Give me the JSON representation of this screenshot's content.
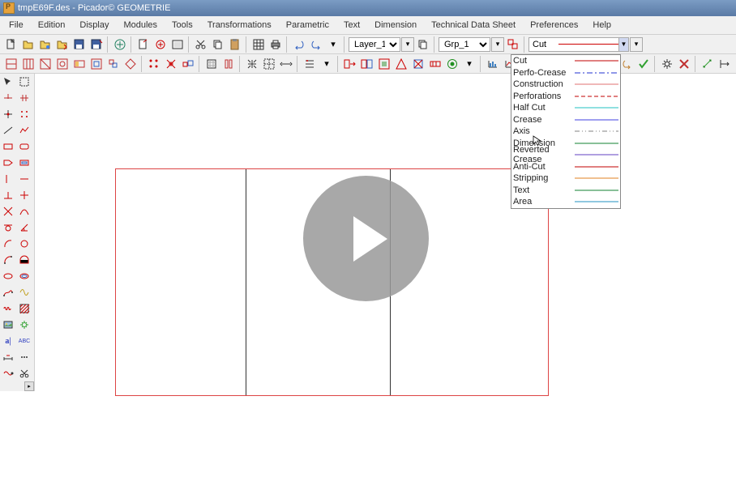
{
  "window": {
    "title": "tmpE69F.des - Picador© GEOMETRIE"
  },
  "menu": {
    "file": "File",
    "edition": "Edition",
    "display": "Display",
    "modules": "Modules",
    "tools": "Tools",
    "transformations": "Transformations",
    "parametric": "Parametric",
    "text": "Text",
    "dimension": "Dimension",
    "tds": "Technical Data Sheet",
    "preferences": "Preferences",
    "help": "Help"
  },
  "toolbar1": {
    "layer_label": "Layer_1",
    "group_label": "Grp_1",
    "linetype_current": "Cut",
    "linetype_color": "#c00000"
  },
  "linetypes": [
    {
      "name": "Cut",
      "line": {
        "type": "solid",
        "color": "#c00000"
      }
    },
    {
      "name": "Perfo-Crease",
      "line": {
        "type": "dashdot",
        "color": "#2030d0"
      }
    },
    {
      "name": "Construction",
      "line": {
        "type": "solid",
        "color": "#e07070"
      }
    },
    {
      "name": "Perforations",
      "line": {
        "type": "dash",
        "color": "#c00000"
      }
    },
    {
      "name": "Half Cut",
      "line": {
        "type": "solid",
        "color": "#20c0c0"
      }
    },
    {
      "name": "Crease",
      "line": {
        "type": "solid",
        "color": "#4040e0"
      }
    },
    {
      "name": "Axis",
      "line": {
        "type": "dashdot2",
        "color": "#808080"
      }
    },
    {
      "name": "Dimension",
      "line": {
        "type": "solid",
        "color": "#108030"
      }
    },
    {
      "name": "Reverted Crease",
      "line": {
        "type": "solid",
        "color": "#6040c0"
      }
    },
    {
      "name": "Anti-Cut",
      "line": {
        "type": "solid",
        "color": "#c00000"
      }
    },
    {
      "name": "Stripping",
      "line": {
        "type": "solid",
        "color": "#e08020"
      }
    },
    {
      "name": "Text",
      "line": {
        "type": "solid",
        "color": "#108030"
      }
    },
    {
      "name": "Area",
      "line": {
        "type": "solid",
        "color": "#2090c0"
      }
    }
  ]
}
